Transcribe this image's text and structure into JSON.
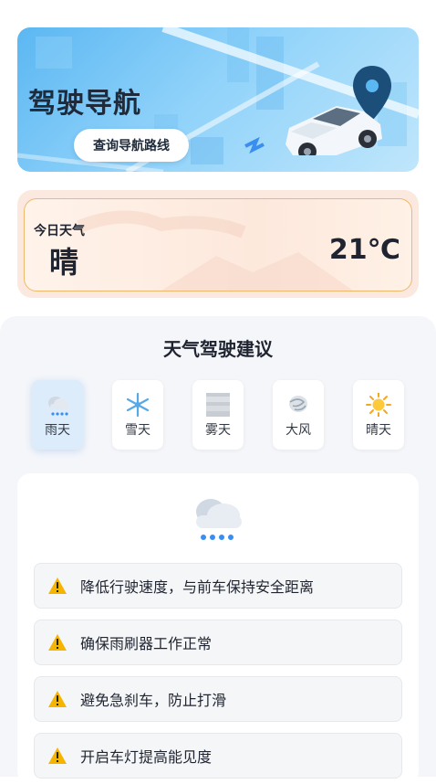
{
  "banner": {
    "title": "驾驶导航",
    "route_button": "查询导航路线",
    "icons": [
      "location-pin-icon",
      "car-icon"
    ]
  },
  "weather": {
    "label": "今日天气",
    "condition": "晴",
    "temperature": "21℃"
  },
  "advice": {
    "title": "天气驾驶建议",
    "tabs": [
      {
        "label": "雨天",
        "icon": "rain-cloud-icon",
        "active": true
      },
      {
        "label": "雪天",
        "icon": "snowflake-icon",
        "active": false
      },
      {
        "label": "雾天",
        "icon": "fog-icon",
        "active": false
      },
      {
        "label": "大风",
        "icon": "wind-icon",
        "active": false
      },
      {
        "label": "晴天",
        "icon": "sun-icon",
        "active": false
      }
    ],
    "selected_icon": "rain-cloud-icon",
    "tips": [
      "降低行驶速度，与前车保持安全距离",
      "确保雨刷器工作正常",
      "避免急刹车，防止打滑",
      "开启车灯提高能见度"
    ]
  },
  "colors": {
    "accent_blue": "#5bb7f2",
    "weather_border": "#f0b86c",
    "warning_yellow": "#f5b400"
  }
}
